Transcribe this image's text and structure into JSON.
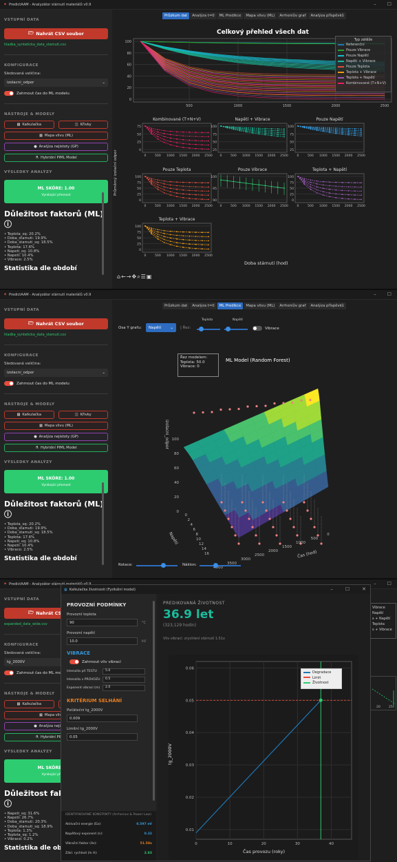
{
  "app": {
    "title": "PredictAAM - Analyzátor stárnutí materiálů v0.9"
  },
  "sidebar": {
    "input_header": "VSTUPNÍ DATA",
    "upload_label": "Nahrát CSV soubor",
    "file1": "hladka_synteticka_data_stamuti.csv",
    "file2": "hladka_synteticka_data_stamuti.csv",
    "file3": "expanded_data_wide.csv",
    "config_header": "KONFIGURACE",
    "tracked_label": "Sledovaná veličina:",
    "tracked_value": "izolacni_odpor",
    "tracked_value3": "tg_2000V",
    "include_time": "Zahrnout čas do ML modelu",
    "tools_header": "NÁSTROJE & MODELY",
    "calc": "Kalkulačka",
    "curves": "Křivky",
    "influence": "Mapa vlivu (ML)",
    "uncertainty": "Analýza nejistoty (GP)",
    "hybrid": "Hybridní PIML Model",
    "results_header": "VÝSLEDKY ANALÝZY",
    "score": "ML SKÓRE: 1.00",
    "score_sub": "Vynikající přesnost",
    "importance_title": "Důležitost faktorů (ML)",
    "factors": [
      "• Teplota_sq: 20.2%",
      "• Doba_stamuti: 19.9%",
      "• Doba_stamuti_sq: 18.5%",
      "• Teplota: 17.6%",
      "• Napeti_sq: 10.8%",
      "• Napeti: 10.4%",
      "• Vibrace: 2.5%"
    ],
    "factors3": [
      "• Napeti_sq: 31.6%",
      "• Napeti: 26.7%",
      "• Doba_stamuti: 20.3%",
      "• Doba_stamuti_sq: 18.9%",
      "• Teplota: 1.3%",
      "• Teplota_sq: 1.2%",
      "• Vibrace: 0.2%"
    ],
    "trail": "Statistika dle období"
  },
  "tabs": [
    "Průzkum dat",
    "Analýza t=0",
    "ML Predikce",
    "Mapa vlivu (ML)",
    "Arrheniův graf",
    "Analýza příspěvků"
  ],
  "panel1": {
    "main_title": "Celkový přehled všech dat",
    "legend_title": "Typ zátěže",
    "legend": [
      "Referenční",
      "Pouze Vibrace",
      "Pouze Napětí",
      "Napětí + Vibrace",
      "Pouze Teplota",
      "Teplota + Vibrace",
      "Teplota + Napětí",
      "Kombinované (T+N+V)"
    ],
    "subtitles": [
      "Kombinované (T+N+V)",
      "Napětí + Vibrace",
      "Pouze Napětí",
      "Pouze Teplota",
      "Pouze Vibrace",
      "Teplota + Napětí",
      "Teplota + Vibrace"
    ],
    "ylabel": "Průměrný izolační odpor",
    "xlabel": "Doba stárnutí (hod)",
    "main_y": [
      "100",
      "80",
      "60",
      "40",
      "20",
      "0"
    ],
    "main_x": [
      "500",
      "1000",
      "1500",
      "2000",
      "2500"
    ],
    "sub_x": [
      "0",
      "500",
      "1000",
      "1500",
      "2000",
      "2500"
    ],
    "colors": [
      "#1f77b4",
      "#2ca02c",
      "#17becf",
      "#1abc9c",
      "#e74c3c",
      "#f39c12",
      "#9b59b6",
      "#e91e63"
    ]
  },
  "panel2": {
    "axis_label": "Osa Y grafu:",
    "axis_value": "Napětí",
    "cut_label": "| Řez:",
    "temp": "Teplota",
    "volt": "Napětí",
    "vib": "Vibrace",
    "chart_title": "ML Model (Random Forest)",
    "info": [
      "Řez modelem:",
      "Teplota: 50.0",
      "Vibrace: 0"
    ],
    "zlabel": "izolacni_odpor",
    "xlabel": "Čas (hod)",
    "ylabel": "Napětí",
    "z_ticks": [
      "100",
      "80",
      "60",
      "40",
      "20",
      "0"
    ],
    "y_ticks": [
      "0",
      "2",
      "4",
      "6",
      "8",
      "10",
      "12",
      "14",
      "16"
    ],
    "x_ticks": [
      "4000",
      "3500",
      "3000",
      "2500",
      "2000",
      "1500",
      "1000",
      "500",
      "0"
    ],
    "rotation": "Rotace:",
    "tilt": "Náklon:"
  },
  "panel3": {
    "bg_legend": [
      "Vibrace",
      "Napětí",
      "s + Napětí",
      "Teplota",
      "s + Vibrace"
    ],
    "bg_ticks": [
      "20",
      "25"
    ],
    "dialog_title": "Kalkulačka životnosti (Fyzikální model)",
    "cond_header": "PROVOZNÍ PODMÍNKY",
    "temp_label": "Provozní teplota",
    "temp_value": "90",
    "temp_unit": "°C",
    "volt_label": "Provozní napětí",
    "volt_value": "10.0",
    "volt_unit": "kV",
    "vib_header": "VIBRACE",
    "vib_toggle": "Zahrnout vliv vibrací",
    "vib_rows": [
      {
        "l": "Intenzita při TESTU",
        "v": "5.0"
      },
      {
        "l": "Intenzita v PROVOZU",
        "v": "0.5"
      },
      {
        "l": "Exponent vibrací (m)",
        "v": "2.0"
      }
    ],
    "fail_header": "KRITÉRIUM SELHÁNÍ",
    "init_label": "Počáteční tg_2000V",
    "init_value": "0.009",
    "limit_label": "Limitní tg_2000V",
    "limit_value": "0.05",
    "const_header": "IDENTIFIKOVANÉ KONSTANTY (Arrhenius & Power Law)",
    "consts": [
      {
        "k": "Aktivační energie (Ea):",
        "v": "0.597 eV"
      },
      {
        "k": "Napěťový exponent (n):",
        "v": "0.32"
      },
      {
        "k": "Vibrační faktor (Av):",
        "v": "51.58x"
      },
      {
        "k": "Zákl. rychlost (ln A):",
        "v": "2.83"
      }
    ],
    "pred_label": "PREDIKOVANÁ ŽIVOTNOST",
    "life": "36.9 let",
    "hours": "(323,129 hodin)",
    "vib_note": "Vliv vibrací: zrychlení stárnutí 1.51x",
    "chart_legend": [
      "Degradace",
      "Limit",
      "Životnost"
    ],
    "ylabel": "tg_2000V",
    "xlabel": "Čas provozu (roky)",
    "y_ticks": [
      "0.06",
      "0.05",
      "0.04",
      "0.03",
      "0.02",
      "0.01"
    ],
    "x_ticks": [
      "0",
      "10",
      "20",
      "30",
      "40"
    ]
  },
  "chart_data": [
    {
      "type": "line",
      "title": "Celkový přehled všech dat",
      "xlabel": "",
      "ylabel": "Průměrný izolační odpor",
      "legend_title": "Typ zátěže",
      "xlim": [
        0,
        2500
      ],
      "ylim": [
        0,
        100
      ],
      "series": [
        {
          "name": "Referenční",
          "x": [
            0,
            2500
          ],
          "y": [
            100,
            96
          ]
        },
        {
          "name": "Pouze Vibrace",
          "x": [
            0,
            2500
          ],
          "y": [
            100,
            95
          ]
        },
        {
          "name": "Pouze Napětí",
          "x": [
            0,
            2500
          ],
          "y": [
            100,
            55
          ]
        },
        {
          "name": "Napětí + Vibrace",
          "x": [
            0,
            2500
          ],
          "y": [
            100,
            45
          ]
        },
        {
          "name": "Pouze Teplota",
          "x": [
            0,
            2500
          ],
          "y": [
            100,
            10
          ]
        },
        {
          "name": "Teplota + Vibrace",
          "x": [
            0,
            2500
          ],
          "y": [
            100,
            6
          ]
        },
        {
          "name": "Teplota + Napětí",
          "x": [
            0,
            2500
          ],
          "y": [
            100,
            3
          ]
        },
        {
          "name": "Kombinované (T+N+V)",
          "x": [
            0,
            2500
          ],
          "y": [
            100,
            0
          ]
        }
      ]
    },
    {
      "type": "line",
      "title": "ML Model (Random Forest)",
      "xlabel": "Čas (hod)",
      "ylabel": "Napětí",
      "zlabel": "izolacni_odpor"
    },
    {
      "type": "line",
      "title": "",
      "xlabel": "Čas provozu (roky)",
      "ylabel": "tg_2000V",
      "xlim": [
        0,
        46
      ],
      "ylim": [
        0.007,
        0.062
      ],
      "series": [
        {
          "name": "Degradace",
          "x": [
            0,
            36.9
          ],
          "y": [
            0.009,
            0.05
          ]
        },
        {
          "name": "Limit",
          "x": [
            0,
            46
          ],
          "y": [
            0.05,
            0.05
          ]
        },
        {
          "name": "Životnost",
          "x": [
            36.9,
            36.9
          ],
          "y": [
            0.007,
            0.062
          ]
        }
      ]
    }
  ]
}
